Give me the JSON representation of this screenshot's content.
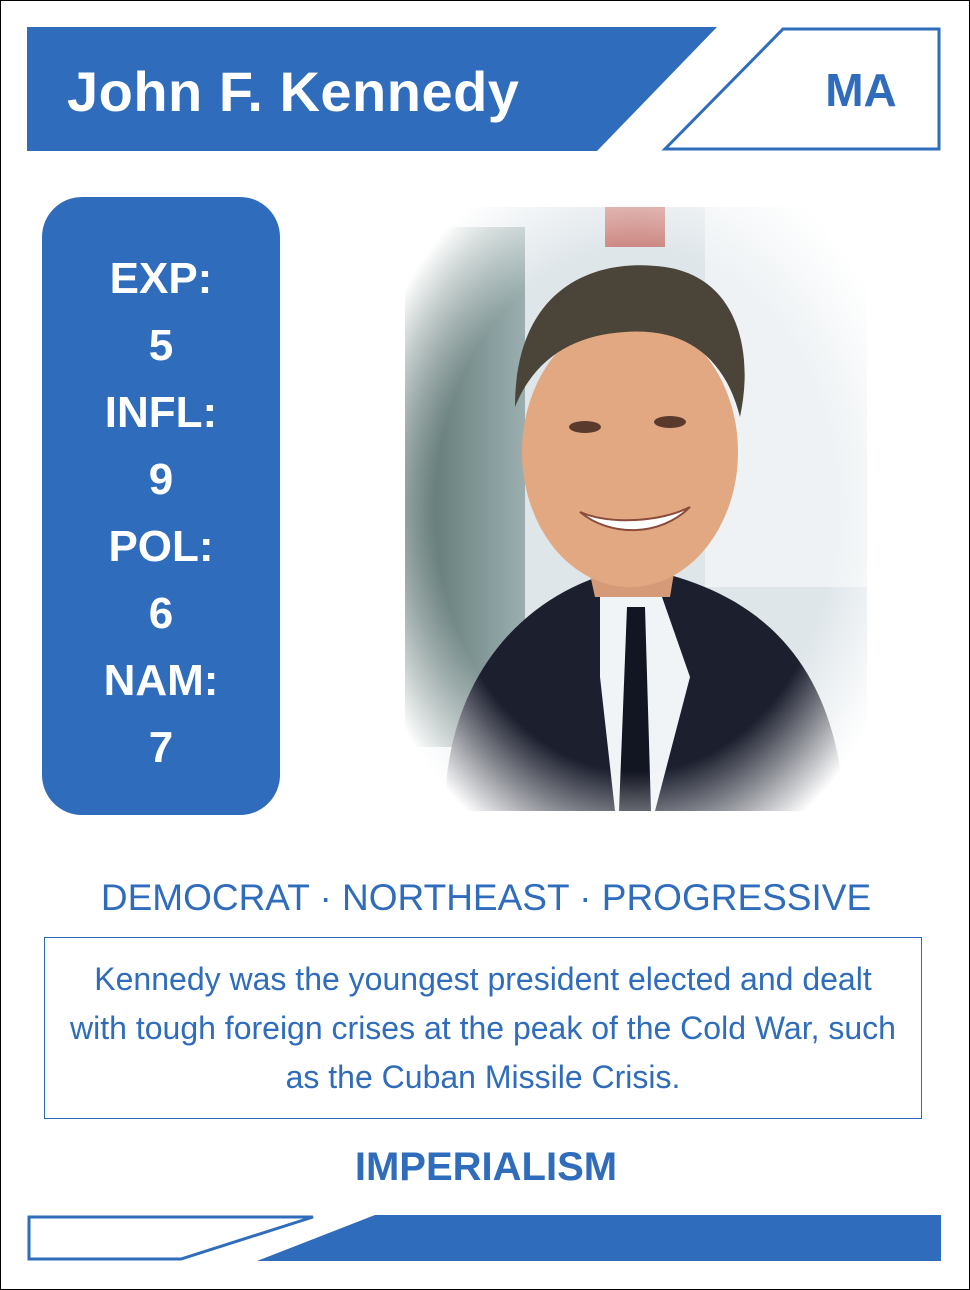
{
  "card": {
    "name": "John F. Kennedy",
    "state": "MA",
    "stats": [
      {
        "label": "EXP:",
        "value": "5"
      },
      {
        "label": "INFL:",
        "value": "9"
      },
      {
        "label": "POL:",
        "value": "6"
      },
      {
        "label": "NAM:",
        "value": "7"
      }
    ],
    "tags": "DEMOCRAT · NORTHEAST · PROGRESSIVE",
    "description": "Kennedy was the youngest president elected and dealt with tough foreign crises at the peak of the Cold War, such as the Cuban Missile Crisis.",
    "ideology": "IMPERIALISM",
    "portrait_icon": "portrait-photo",
    "colors": {
      "accent": "#2f6cbc",
      "text_on_accent": "#ffffff",
      "background": "#ffffff"
    }
  }
}
